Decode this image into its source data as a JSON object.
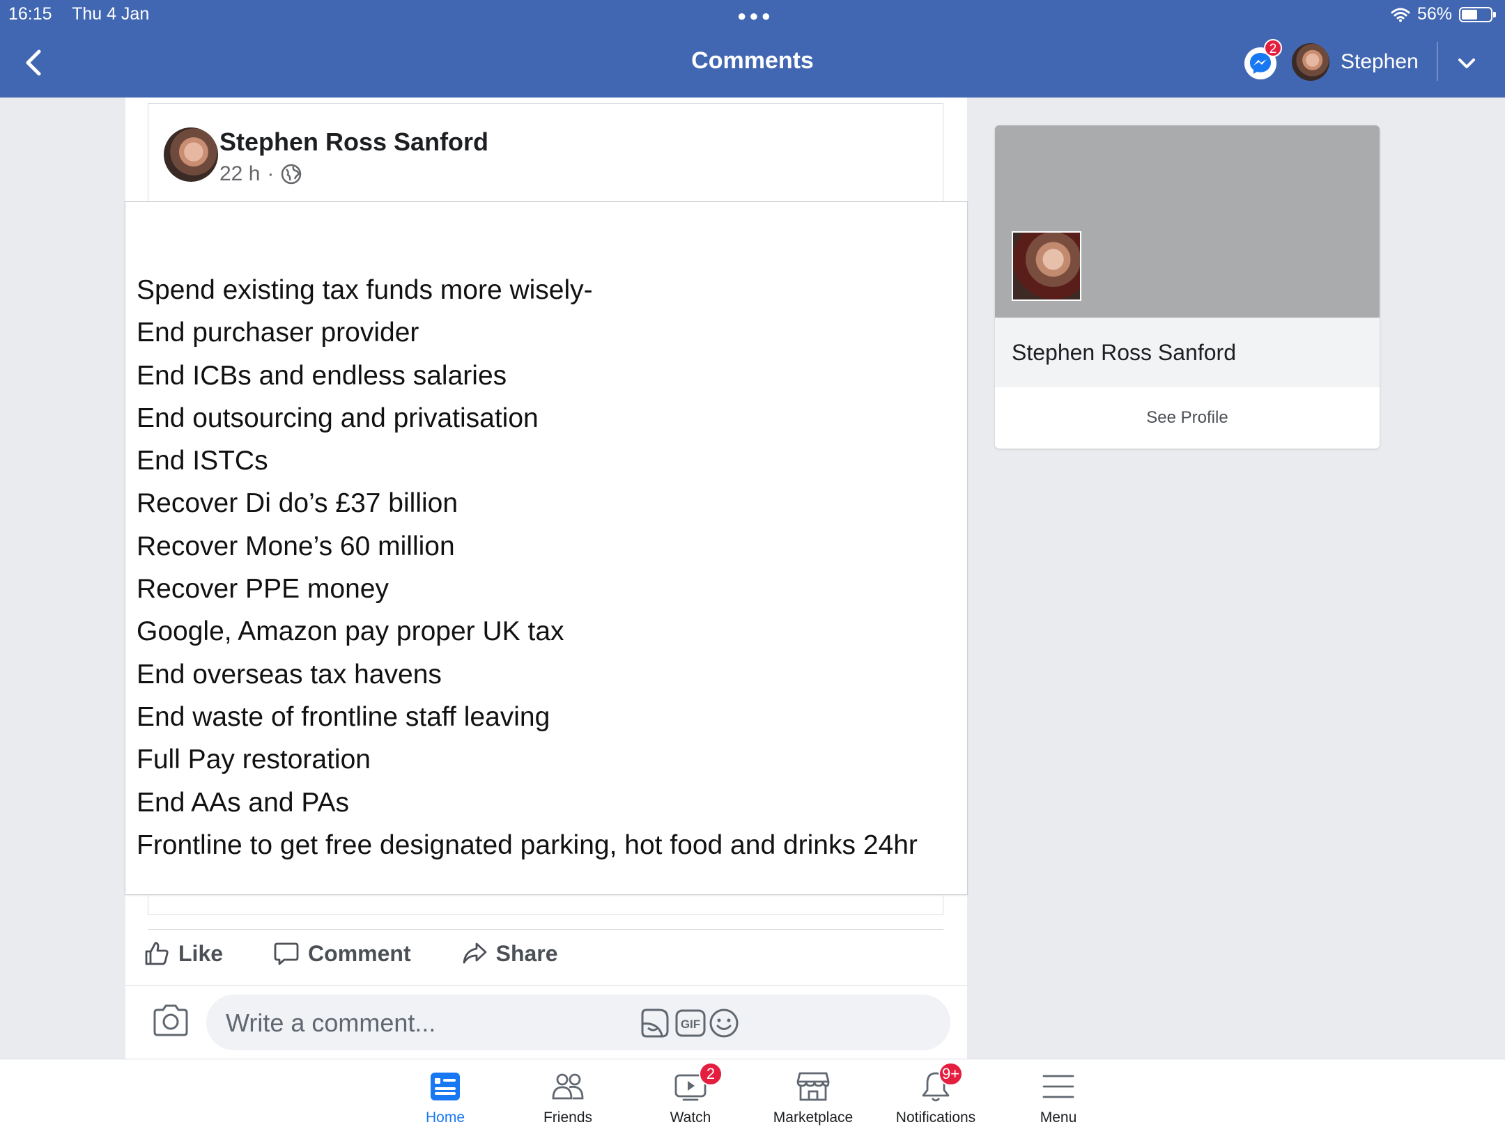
{
  "status_bar": {
    "time": "16:15",
    "date": "Thu 4 Jan",
    "battery": "56%"
  },
  "header": {
    "title": "Comments",
    "messenger_badge": "2",
    "profile_name": "Stephen"
  },
  "post": {
    "author": "Stephen Ross Sanford",
    "time": "22 h",
    "lines": [
      "Spend existing tax funds more wisely-",
      "End purchaser provider",
      "End ICBs and endless salaries",
      "End outsourcing and privatisation",
      "End ISTCs",
      "Recover Di do’s £37 billion",
      "Recover Mone’s 60 million",
      "Recover PPE money",
      "Google, Amazon pay proper UK tax",
      "End overseas tax havens",
      "End waste of frontline staff leaving",
      "Full Pay restoration",
      "End AAs and PAs",
      "Frontline to get free designated parking, hot food and drinks 24hr"
    ],
    "actions": {
      "like": "Like",
      "comment": "Comment",
      "share": "Share"
    },
    "comment_placeholder": "Write a comment..."
  },
  "profile_card": {
    "name": "Stephen Ross Sanford",
    "see_profile": "See Profile"
  },
  "tabbar": {
    "tabs": [
      {
        "label": "Home",
        "icon": "home-icon",
        "active": true
      },
      {
        "label": "Friends",
        "icon": "friends-icon"
      },
      {
        "label": "Watch",
        "icon": "watch-icon",
        "badge": "2"
      },
      {
        "label": "Marketplace",
        "icon": "marketplace-icon"
      },
      {
        "label": "Notifications",
        "icon": "bell-icon",
        "badge": "9+"
      },
      {
        "label": "Menu",
        "icon": "menu-icon"
      }
    ]
  },
  "colors": {
    "brand": "#4267b2",
    "active_tab": "#1877f2",
    "badge": "#e41e3f"
  }
}
